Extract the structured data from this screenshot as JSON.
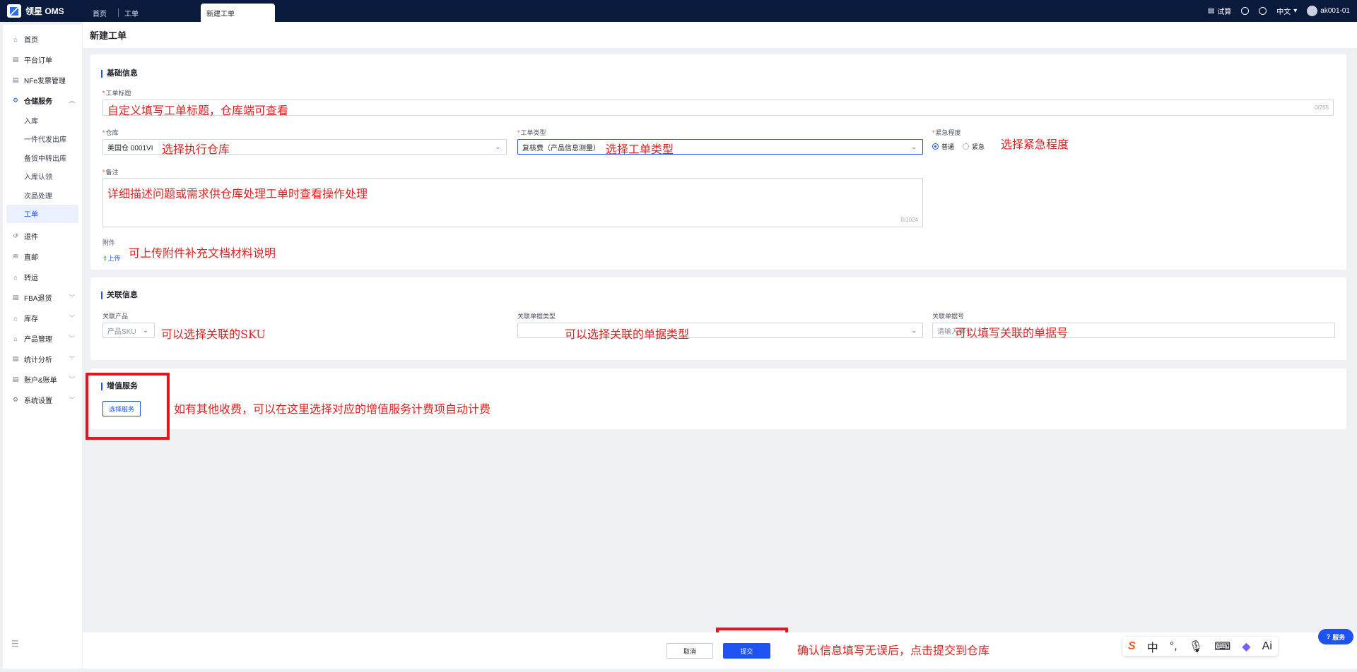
{
  "app": {
    "name": "领星 OMS"
  },
  "tabs": [
    {
      "label": "首页"
    },
    {
      "label": "工单"
    },
    {
      "label": "新建工单"
    }
  ],
  "topbar": {
    "trial": "试算",
    "language": "中文",
    "user": "ak001-01"
  },
  "sidebar": {
    "items": [
      {
        "label": "首页"
      },
      {
        "label": "平台订单"
      },
      {
        "label": "NFe发票管理"
      },
      {
        "label": "仓储服务"
      },
      {
        "label": "退件"
      },
      {
        "label": "直邮"
      },
      {
        "label": "转运"
      },
      {
        "label": "FBA退货"
      },
      {
        "label": "库存"
      },
      {
        "label": "产品管理"
      },
      {
        "label": "统计分析"
      },
      {
        "label": "账户&账单"
      },
      {
        "label": "系统设置"
      }
    ],
    "sub_items": [
      {
        "label": "入库"
      },
      {
        "label": "一件代发出库"
      },
      {
        "label": "备货中转出库"
      },
      {
        "label": "入库认领"
      },
      {
        "label": "次品处理"
      },
      {
        "label": "工单"
      }
    ]
  },
  "page": {
    "title": "新建工单"
  },
  "basic": {
    "section_title": "基础信息",
    "title_label": "工单标题",
    "title_counter": "0/255",
    "warehouse_label": "仓库",
    "warehouse_value": "美国仓 0001VI",
    "type_label": "工单类型",
    "type_value": "复核费（产品信息测量）",
    "urgency_label": "紧急程度",
    "urgency_normal": "普通",
    "urgency_urgent": "紧急",
    "remark_label": "备注",
    "remark_counter": "0/1024",
    "attach_label": "附件",
    "upload_label": "上传"
  },
  "related": {
    "section_title": "关联信息",
    "product_label": "关联产品",
    "product_placeholder": "产品SKU",
    "doc_type_label": "关联单据类型",
    "doc_no_label": "关联单据号",
    "doc_no_placeholder": "请输入单号"
  },
  "value_added": {
    "section_title": "增值服务",
    "select_button": "选择服务"
  },
  "footer": {
    "cancel": "取消",
    "submit": "提交"
  },
  "annotations": {
    "title": "自定义填写工单标题，仓库端可查看",
    "warehouse": "选择执行仓库",
    "type": "选择工单类型",
    "urgency": "选择紧急程度",
    "remark": "详细描述问题或需求供仓库处理工单时查看操作处理",
    "attach": "可上传附件补充文档材料说明",
    "sku": "可以选择关联的SKU",
    "doc_type": "可以选择关联的单据类型",
    "doc_no": "可以填写关联的单据号",
    "value_added": "如有其他收费，可以在这里选择对应的增值服务计费项自动计费",
    "submit": "确认信息填写无误后，点击提交到仓库"
  },
  "ime": {
    "chinese": "中",
    "ai": "Ai"
  },
  "service_widget": {
    "label": "服务"
  },
  "colors": {
    "accent": "#1e52f3",
    "annotation": "#e02020",
    "topbar": "#0a1a3d"
  }
}
